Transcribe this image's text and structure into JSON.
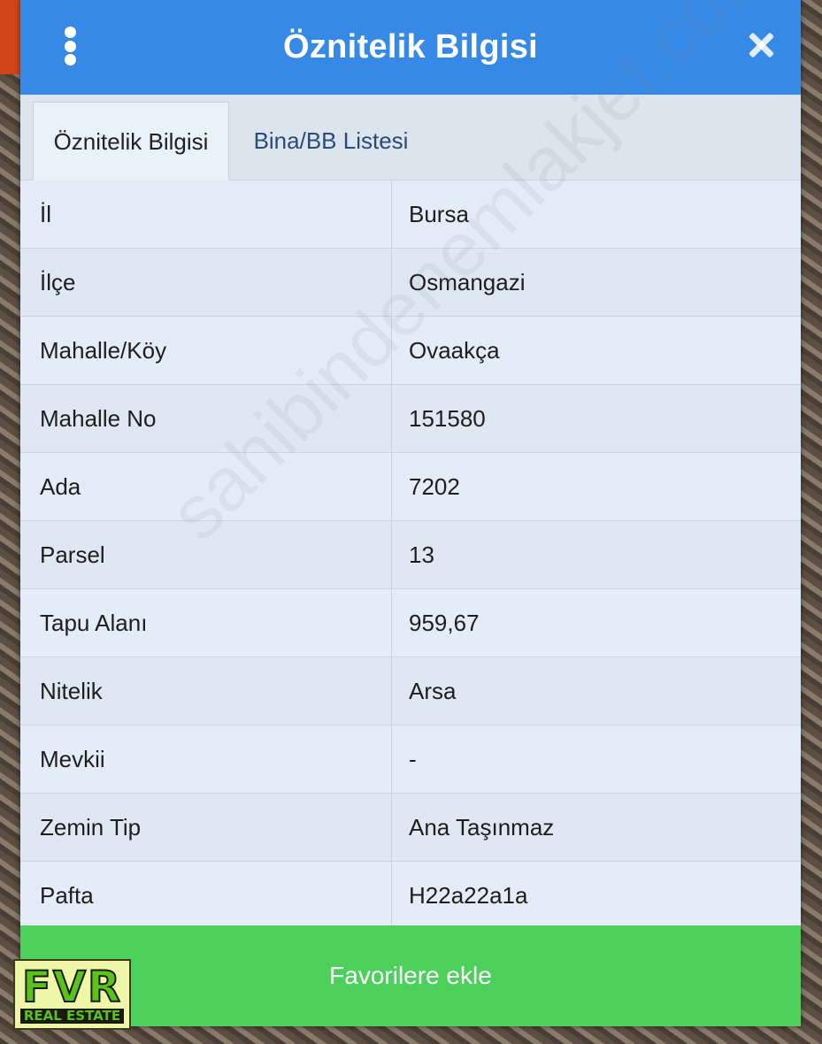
{
  "dialog": {
    "title": "Öznitelik Bilgisi"
  },
  "tabs": [
    {
      "label": "Öznitelik Bilgisi",
      "active": true
    },
    {
      "label": "Bina/BB Listesi",
      "active": false
    }
  ],
  "attributes": [
    {
      "key": "İl",
      "value": "Bursa"
    },
    {
      "key": "İlçe",
      "value": "Osmangazi"
    },
    {
      "key": "Mahalle/Köy",
      "value": "Ovaakça"
    },
    {
      "key": "Mahalle No",
      "value": "151580"
    },
    {
      "key": "Ada",
      "value": "7202"
    },
    {
      "key": "Parsel",
      "value": "13"
    },
    {
      "key": "Tapu Alanı",
      "value": "959,67"
    },
    {
      "key": "Nitelik",
      "value": "Arsa"
    },
    {
      "key": "Mevkii",
      "value": "-"
    },
    {
      "key": "Zemin Tip",
      "value": "Ana Taşınmaz"
    },
    {
      "key": "Pafta",
      "value": "H22a22a1a"
    }
  ],
  "footer": {
    "favorite_label": "Favorilere ekle"
  },
  "watermark": "sahibindenemlakjet.com",
  "logo": {
    "main": "FVR",
    "sub": "REAL ESTATE"
  },
  "colors": {
    "titlebar": "#3789e6",
    "favorite_button": "#4dcf5c",
    "panel": "#dfe9f4"
  },
  "icons": {
    "menu": "vertical-dots-icon",
    "close": "close-icon"
  }
}
